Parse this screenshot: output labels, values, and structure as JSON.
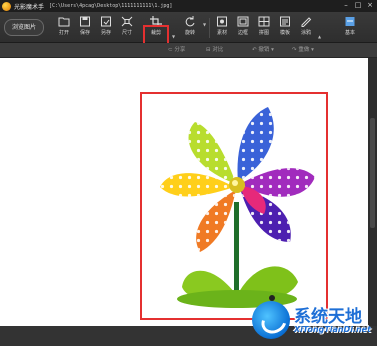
{
  "window": {
    "app_name": "光影魔术手",
    "file_path": "[C:\\Users\\4pcag\\Desktop\\1111111111\\1.jpg]"
  },
  "toolbar": {
    "browse_label": "浏览图片",
    "tools": [
      {
        "label": "打开",
        "icon": "folder-icon"
      },
      {
        "label": "保存",
        "icon": "save-icon"
      },
      {
        "label": "另存",
        "icon": "save-as-icon"
      },
      {
        "label": "尺寸",
        "icon": "resize-icon"
      },
      {
        "label": "裁剪",
        "icon": "crop-icon"
      },
      {
        "label": "旋转",
        "icon": "rotate-icon"
      },
      {
        "label": "素材",
        "icon": "material-icon"
      },
      {
        "label": "边框",
        "icon": "border-icon"
      },
      {
        "label": "拼图",
        "icon": "puzzle-icon"
      },
      {
        "label": "模板",
        "icon": "template-icon"
      },
      {
        "label": "涂鸦",
        "icon": "doodle-icon"
      },
      {
        "label": "基本",
        "icon": "basic-icon"
      }
    ],
    "highlighted_tool": "裁剪"
  },
  "subbar": {
    "items": [
      "分享",
      "对比",
      "撤销",
      "重做"
    ]
  },
  "watermark": {
    "title": "系统天地",
    "url": "XiTongTianDi.net"
  },
  "colors": {
    "highlight_red": "#e43030",
    "watermark_blue": "#1e6fd6"
  }
}
